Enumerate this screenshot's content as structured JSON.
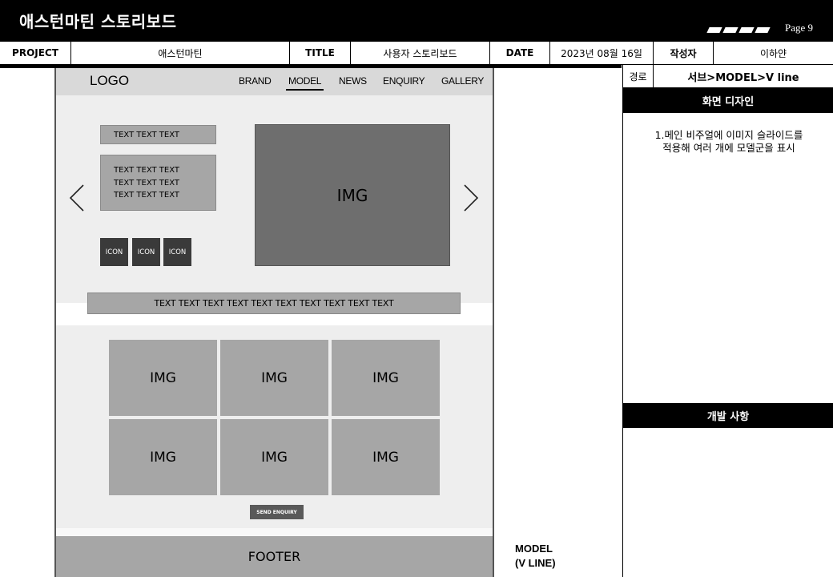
{
  "header": {
    "doc_title": "애스턴마틴 스토리보드",
    "page_label": "Page 9"
  },
  "info": {
    "project_label": "PROJECT",
    "project_value": "애스턴마틴",
    "title_label": "TITLE",
    "title_value": "사용자 스토리보드",
    "date_label": "DATE",
    "date_value": "2023년 08월 16일",
    "author_label": "작성자",
    "author_value": "이하얀"
  },
  "panel": {
    "path_label": "경로",
    "path_value": "서브>MODEL>V  line",
    "design_heading": "화면 디자인",
    "design_desc_line1": "1.메인 비주얼에 이미지 슬라이드를",
    "design_desc_line2": "적용해 여러 개에 모델군을 표시",
    "dev_heading": "개발 사항"
  },
  "wireframe": {
    "logo": "LOGO",
    "nav": [
      "BRAND",
      "MODEL",
      "NEWS",
      "ENQUIRY",
      "GALLERY"
    ],
    "active_nav": "MODEL",
    "text_bar": "TEXT TEXT TEXT",
    "text_box_lines": [
      "TEXT TEXT TEXT",
      "TEXT TEXT TEXT",
      "TEXT TEXT TEXT"
    ],
    "icons": [
      "ICON",
      "ICON",
      "ICON"
    ],
    "hero_img": "IMG",
    "wide_text": "TEXT TEXT TEXT TEXT TEXT TEXT TEXT TEXT TEXT TEXT",
    "grid_imgs": [
      "IMG",
      "IMG",
      "IMG",
      "IMG",
      "IMG",
      "IMG"
    ],
    "send_button": "SEND ENQUIRY",
    "footer": "FOOTER"
  },
  "caption": {
    "line1": "MODEL",
    "line2": "(V LINE)"
  },
  "icons": {
    "prev": "chevron-left-icon",
    "next": "chevron-right-icon"
  }
}
